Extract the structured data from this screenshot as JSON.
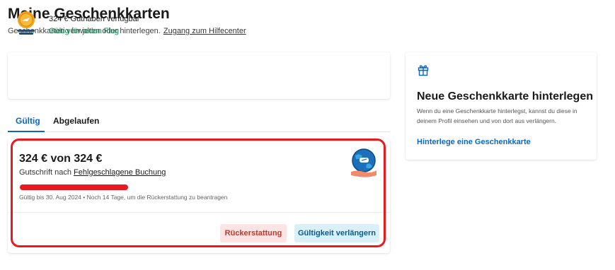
{
  "header": {
    "title": "Meine Geschenkkarten",
    "subtitle": "Geschenkkarten verwalten oder hinterlegen.",
    "help_link": "Zugang zum Hilfecenter"
  },
  "balance": {
    "amount_text": "324 € Guthaben verfügbar",
    "valid_text": "Gültig für jeden Flug",
    "icon": "coin-icon"
  },
  "tabs": [
    {
      "label": "Gültig",
      "active": true
    },
    {
      "label": "Abgelaufen",
      "active": false
    }
  ],
  "gift_card": {
    "amount": "324 € von 324 €",
    "credit_prefix": "Gutschrift nach",
    "credit_link": "Fehlgeschlagene Buchung",
    "validity": "Gültig bis 30. Aug 2024 • Noch 14 Tage, um die Rückerstattung zu beantragen",
    "icon": "globe-hand-icon",
    "buttons": {
      "refund": "Rückerstattung",
      "extend": "Gültigkeit verlängern"
    }
  },
  "new_card": {
    "title": "Neue Geschenkkarte hinterlegen",
    "description": "Wenn du eine Geschenkkarte hinterlegst, kannst du diese in deinem Profil einsehen und von dort aus verlängern.",
    "link": "Hinterlege eine Geschenkkarte",
    "icon": "gift-icon"
  },
  "colors": {
    "accent": "#0a67c2",
    "valid_green": "#0a8a50",
    "highlight_red": "#e8191f",
    "refund_bg": "#fde4e4",
    "extend_bg": "#d9f0f8"
  }
}
